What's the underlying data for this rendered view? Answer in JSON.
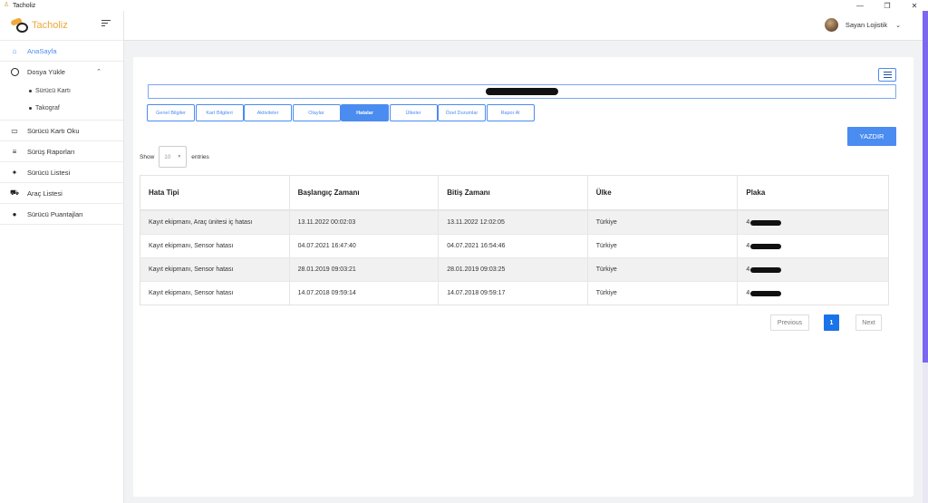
{
  "window": {
    "title": "Tacholiz",
    "controls": [
      "—",
      "❐",
      "✕"
    ]
  },
  "sidebar": {
    "brand": "Tacholiz",
    "items": [
      {
        "label": "AnaSayfa",
        "icon": "home-icon",
        "glyph": "⌂",
        "active": true
      },
      {
        "label": "Dosya Yükle",
        "icon": "circle-icon",
        "glyph": "",
        "expanded": true,
        "children": [
          {
            "label": "Sürücü Kartı"
          },
          {
            "label": "Takograf"
          }
        ]
      },
      {
        "label": "Sürücü Kartı Oku",
        "icon": "card-icon",
        "glyph": "▭"
      },
      {
        "label": "Sürüş Raporları",
        "icon": "list-icon",
        "glyph": "≡"
      },
      {
        "label": "Sürücü Listesi",
        "icon": "person-icon",
        "glyph": "✦"
      },
      {
        "label": "Araç Listesi",
        "icon": "truck-icon",
        "glyph": "⛟"
      },
      {
        "label": "Sürücü Puantajları",
        "icon": "user-icon",
        "glyph": "●"
      }
    ]
  },
  "header": {
    "user_name": "Sayan Lojistik"
  },
  "tabs": [
    {
      "label": "Genel Bilgiler"
    },
    {
      "label": "Kart Bilgileri"
    },
    {
      "label": "Aktiviteler"
    },
    {
      "label": "Olaylar"
    },
    {
      "label": "Hatalar",
      "active": true
    },
    {
      "label": "Ülkeler"
    },
    {
      "label": "Özel Durumlar"
    },
    {
      "label": "Rapor Al"
    }
  ],
  "print_label": "YAZDIR",
  "entries": {
    "show": "Show",
    "value": "10",
    "suffix": "entries"
  },
  "table": {
    "columns": [
      "Hata Tipi",
      "Başlangıç Zamanı",
      "Bitiş Zamanı",
      "Ülke",
      "Plaka"
    ],
    "rows": [
      [
        "Kayıt ekipmanı, Araç ünitesi iç hatası",
        "13.11.2022 00:02:03",
        "13.11.2022 12:02:05",
        "Türkiye",
        "4"
      ],
      [
        "Kayıt ekipmanı, Sensor hatası",
        "04.07.2021 16:47:40",
        "04.07.2021 16:54:46",
        "Türkiye",
        "4"
      ],
      [
        "Kayıt ekipmanı, Sensor hatası",
        "28.01.2019 09:03:21",
        "28.01.2019 09:03:25",
        "Türkiye",
        "4"
      ],
      [
        "Kayıt ekipmanı, Sensor hatası",
        "14.07.2018 09:59:14",
        "14.07.2018 09:59:17",
        "Türkiye",
        "4"
      ]
    ]
  },
  "pagination": {
    "previous": "Previous",
    "current": "1",
    "next": "Next"
  }
}
